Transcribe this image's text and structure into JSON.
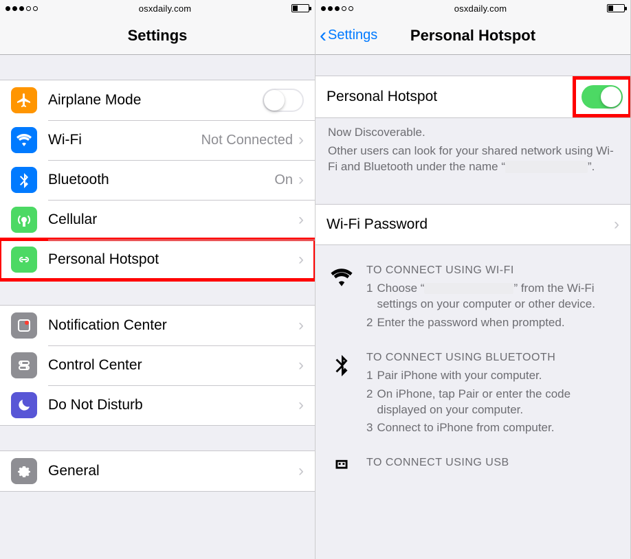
{
  "status": {
    "url": "osxdaily.com"
  },
  "left": {
    "title": "Settings",
    "rows": {
      "airplane": {
        "label": "Airplane Mode"
      },
      "wifi": {
        "label": "Wi-Fi",
        "value": "Not Connected"
      },
      "bluetooth": {
        "label": "Bluetooth",
        "value": "On"
      },
      "cellular": {
        "label": "Cellular"
      },
      "hotspot": {
        "label": "Personal Hotspot"
      },
      "notif": {
        "label": "Notification Center"
      },
      "control": {
        "label": "Control Center"
      },
      "dnd": {
        "label": "Do Not Disturb"
      },
      "general": {
        "label": "General"
      }
    }
  },
  "right": {
    "back": "Settings",
    "title": "Personal Hotspot",
    "toggle_label": "Personal Hotspot",
    "discoverable_title": "Now Discoverable.",
    "discoverable_body_a": "Other users can look for your shared network using Wi-Fi and Bluetooth under the name “",
    "discoverable_body_b": "”.",
    "wifi_password": "Wi-Fi Password",
    "instr": {
      "wifi": {
        "title": "TO CONNECT USING WI-FI",
        "step1a": "Choose “",
        "step1b": "” from the Wi-Fi settings on your computer or other device.",
        "step2": "Enter the password when prompted."
      },
      "bt": {
        "title": "TO CONNECT USING BLUETOOTH",
        "step1": "Pair iPhone with your computer.",
        "step2": "On iPhone, tap Pair or enter the code displayed on your computer.",
        "step3": "Connect to iPhone from computer."
      },
      "usb": {
        "title": "TO CONNECT USING USB"
      }
    }
  }
}
